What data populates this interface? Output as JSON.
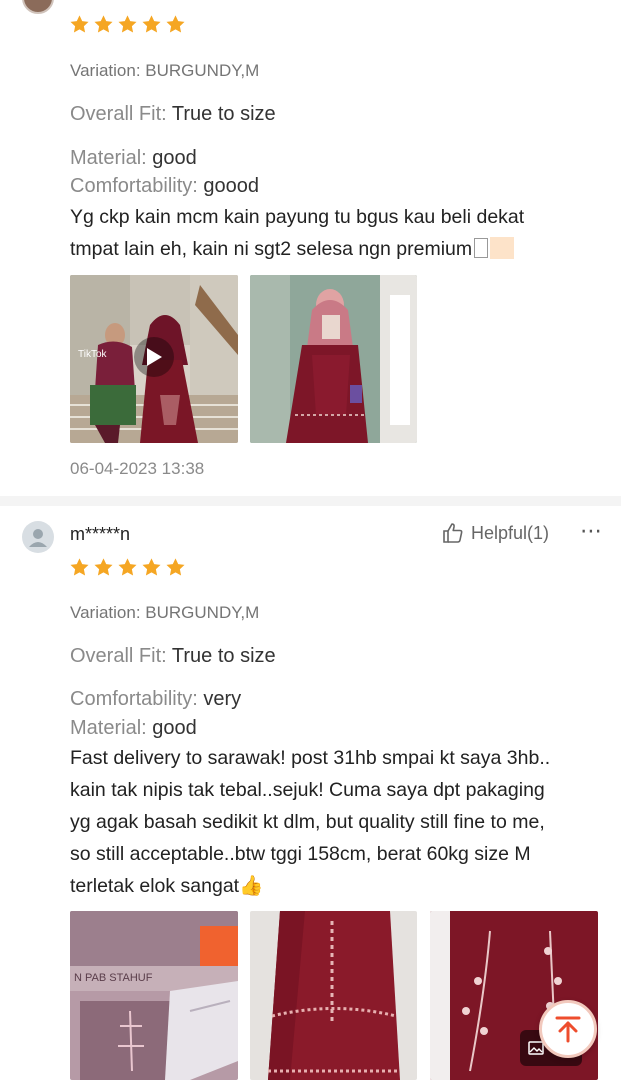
{
  "review1": {
    "rating": 5,
    "variation": "Variation: BURGUNDY,M",
    "fit_label": "Overall Fit:",
    "fit_value": "True to size",
    "attr1_label": "Material:",
    "attr1_value": "good",
    "attr2_label": "Comfortability:",
    "attr2_value": "goood",
    "body_line1": "Yg ckp kain mcm kain payung tu bgus kau beli dekat",
    "body_line2": "tmpat lain eh, kain ni sgt2 selesa ngn premium",
    "video_watermark": "TikTok",
    "date": "06-04-2023 13:38"
  },
  "review2": {
    "username": "m*****n",
    "helpful_label": "Helpful(1)",
    "more_label": "⋯",
    "rating": 5,
    "variation": "Variation: BURGUNDY,M",
    "fit_label": "Overall Fit:",
    "fit_value": "True to size",
    "attr1_label": "Comfortability:",
    "attr1_value": "very",
    "attr2_label": "Material:",
    "attr2_value": "good",
    "body_lines": [
      "Fast delivery to sarawak! post 31hb smpai kt saya 3hb..",
      "kain tak nipis tak tebal..sejuk! Cuma saya dpt pakaging",
      "yg agak basah sedikit kt dlm, but quality still fine to me,",
      "so still acceptable..btw tggi 158cm, berat 60kg size M",
      "terletak elok sangat👍"
    ],
    "media_count": "+1"
  },
  "icons": {
    "star": "star-icon",
    "thumb": "thumbs-up-icon",
    "play": "play-icon",
    "user": "user-icon",
    "back_to_top": "arrow-up-to-top-icon"
  },
  "colors": {
    "star": "#f5a623",
    "accent": "#ee4d2d",
    "burgundy": "#7a1626"
  }
}
